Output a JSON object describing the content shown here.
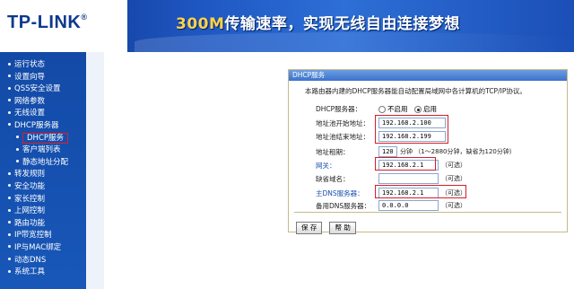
{
  "header": {
    "logo": "TP-LINK",
    "logo_mark": "®",
    "banner_highlight": "300M",
    "banner_text": "传输速率，实现无线自由连接梦想"
  },
  "sidebar": {
    "items": [
      {
        "label": "运行状态"
      },
      {
        "label": "设置向导"
      },
      {
        "label": "QSS安全设置"
      },
      {
        "label": "网络参数"
      },
      {
        "label": "无线设置"
      },
      {
        "label": "DHCP服务器"
      },
      {
        "label": "DHCP服务",
        "sub": true,
        "active": true
      },
      {
        "label": "客户端列表",
        "sub": true
      },
      {
        "label": "静态地址分配",
        "sub": true
      },
      {
        "label": "转发规则"
      },
      {
        "label": "安全功能"
      },
      {
        "label": "家长控制"
      },
      {
        "label": "上网控制"
      },
      {
        "label": "路由功能"
      },
      {
        "label": "IP带宽控制"
      },
      {
        "label": "IP与MAC绑定"
      },
      {
        "label": "动态DNS"
      },
      {
        "label": "系统工具"
      }
    ]
  },
  "panel": {
    "title": "DHCP服务",
    "description": "本路由器内建的DHCP服务器能自动配置局域网中各计算机的TCP/IP协议。",
    "dhcp_server": {
      "label": "DHCP服务器：",
      "off": "不启用",
      "on": "启用",
      "selected": "on"
    },
    "start_ip": {
      "label": "地址池开始地址：",
      "value": "192.168.2.100"
    },
    "end_ip": {
      "label": "地址池结束地址：",
      "value": "192.168.2.199"
    },
    "lease": {
      "label": "地址租期：",
      "value": "120",
      "hint": "分钟 （1～2880分钟，缺省为120分钟）"
    },
    "gateway": {
      "label": "网关：",
      "value": "192.168.2.1",
      "hint": "（可选）"
    },
    "domain": {
      "label": "缺省域名：",
      "value": "",
      "hint": "（可选）"
    },
    "dns1": {
      "label": "主DNS服务器：",
      "value": "192.168.2.1",
      "hint": "（可选）"
    },
    "dns2": {
      "label": "备用DNS服务器：",
      "value": "0.0.0.0",
      "hint": "（可选）"
    },
    "save": "保 存",
    "help": "帮 助"
  }
}
